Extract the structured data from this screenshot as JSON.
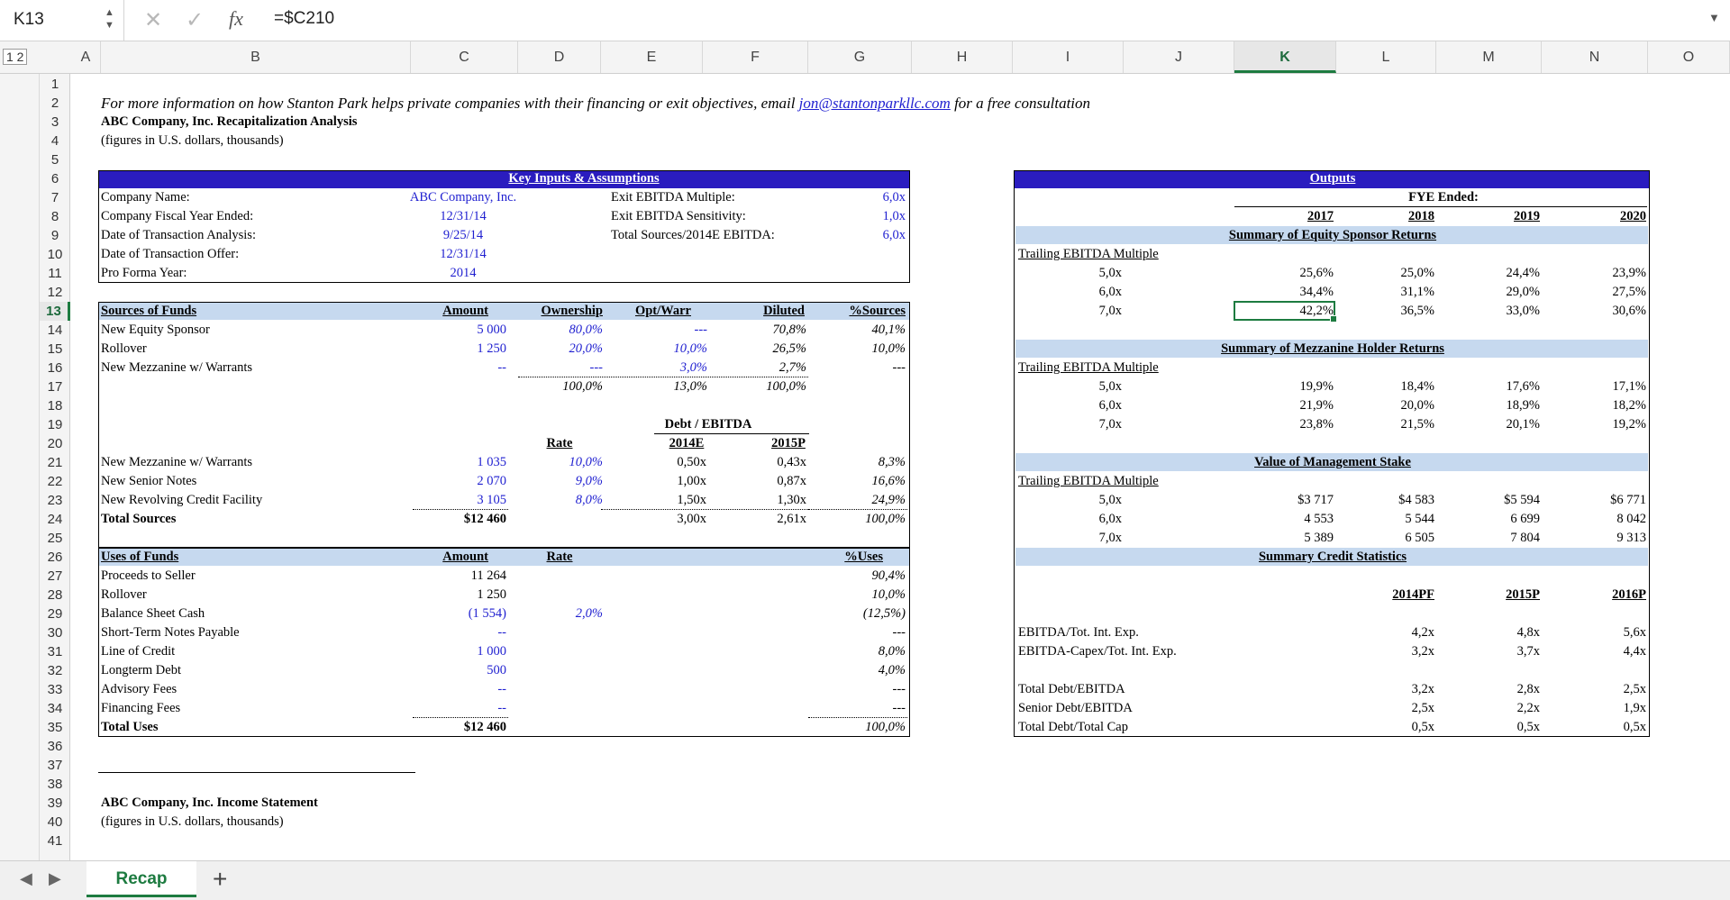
{
  "formula_bar": {
    "name_box": "K13",
    "fx": "fx",
    "formula": "=$C210"
  },
  "columns": [
    "A",
    "B",
    "C",
    "D",
    "E",
    "F",
    "G",
    "H",
    "I",
    "J",
    "K",
    "L",
    "M",
    "N",
    "O"
  ],
  "outline_levels": "1 2",
  "rows": [
    "1",
    "2",
    "3",
    "4",
    "5",
    "6",
    "7",
    "8",
    "9",
    "10",
    "11",
    "12",
    "13",
    "14",
    "15",
    "16",
    "17",
    "18",
    "19",
    "20",
    "21",
    "22",
    "23",
    "24",
    "25",
    "26",
    "27",
    "28",
    "29",
    "30",
    "31",
    "32",
    "33",
    "34",
    "35",
    "36",
    "37",
    "38",
    "39",
    "40",
    "41"
  ],
  "header": {
    "info_pre": "For more information on how Stanton Park helps private companies with their financing or exit objectives, email ",
    "info_email": "jon@stantonparkllc.com",
    "info_post": " for a free consultation",
    "title": "ABC Company, Inc. Recapitalization Analysis",
    "subtitle": "(figures in U.S. dollars, thousands)"
  },
  "key_inputs": {
    "title": "Key Inputs & Assumptions",
    "labels": [
      "Company Name:",
      "Company Fiscal Year Ended:",
      "Date of Transaction Analysis:",
      "Date of Transaction Offer:",
      "Pro Forma Year:"
    ],
    "values": [
      "ABC Company, Inc.",
      "12/31/14",
      "9/25/14",
      "12/31/14",
      "2014"
    ],
    "right_labels": [
      "Exit EBITDA Multiple:",
      "Exit EBITDA Sensitivity:",
      "Total Sources/2014E EBITDA:"
    ],
    "right_values": [
      "6,0x",
      "1,0x",
      "6,0x"
    ]
  },
  "sources": {
    "headers": [
      "Sources of Funds",
      "Amount",
      "Ownership",
      "Opt/Warr",
      "Diluted",
      "%Sources"
    ],
    "rows": [
      {
        "label": "New Equity Sponsor",
        "amount": "5 000",
        "own": "80,0%",
        "opt": "---",
        "dil": "70,8%",
        "pct": "40,1%"
      },
      {
        "label": "Rollover",
        "amount": "1 250",
        "own": "20,0%",
        "opt": "10,0%",
        "dil": "26,5%",
        "pct": "10,0%"
      },
      {
        "label": "New Mezzanine w/ Warrants",
        "amount": "--",
        "own": "---",
        "opt": "3,0%",
        "dil": "2,7%",
        "pct": "---"
      }
    ],
    "totals": {
      "own": "100,0%",
      "opt": "13,0%",
      "dil": "100,0%"
    },
    "debt_ebitda_title": "Debt / EBITDA",
    "rate_header": "Rate",
    "year_headers": [
      "2014E",
      "2015P"
    ],
    "debt_rows": [
      {
        "label": "New Mezzanine w/ Warrants",
        "amount": "1 035",
        "rate": "10,0%",
        "y1": "0,50x",
        "y2": "0,43x",
        "pct": "8,3%"
      },
      {
        "label": "New Senior Notes",
        "amount": "2 070",
        "rate": "9,0%",
        "y1": "1,00x",
        "y2": "0,87x",
        "pct": "16,6%"
      },
      {
        "label": "New Revolving Credit Facility",
        "amount": "3 105",
        "rate": "8,0%",
        "y1": "1,50x",
        "y2": "1,30x",
        "pct": "24,9%"
      }
    ],
    "total_label": "Total Sources",
    "total": {
      "amount": "$12 460",
      "y1": "3,00x",
      "y2": "2,61x",
      "pct": "100,0%"
    }
  },
  "uses": {
    "headers": [
      "Uses of Funds",
      "Amount",
      "Rate",
      "%Uses"
    ],
    "rows": [
      {
        "label": "Proceeds to Seller",
        "amount": "11 264",
        "rate": "",
        "pct": "90,4%"
      },
      {
        "label": "Rollover",
        "amount": "1 250",
        "rate": "",
        "pct": "10,0%"
      },
      {
        "label": "Balance Sheet Cash",
        "amount": "(1 554)",
        "rate": "2,0%",
        "pct": "(12,5%)"
      },
      {
        "label": "Short-Term Notes Payable",
        "amount": "--",
        "rate": "",
        "pct": "---"
      },
      {
        "label": "Line of Credit",
        "amount": "1 000",
        "rate": "",
        "pct": "8,0%"
      },
      {
        "label": "Longterm Debt",
        "amount": "500",
        "rate": "",
        "pct": "4,0%"
      },
      {
        "label": "Advisory Fees",
        "amount": "--",
        "rate": "",
        "pct": "---"
      },
      {
        "label": "Financing Fees",
        "amount": "--",
        "rate": "",
        "pct": "---"
      }
    ],
    "total_label": "Total Uses",
    "total": {
      "amount": "$12 460",
      "pct": "100,0%"
    }
  },
  "outputs": {
    "title": "Outputs",
    "fye": "FYE Ended:",
    "years": [
      "2017",
      "2018",
      "2019",
      "2020"
    ],
    "equity_title": "Summary of Equity Sponsor Returns",
    "multiple_label": "Trailing EBITDA Multiple",
    "multiples": [
      "5,0x",
      "6,0x",
      "7,0x"
    ],
    "equity": [
      [
        "25,6%",
        "25,0%",
        "24,4%",
        "23,9%"
      ],
      [
        "34,4%",
        "31,1%",
        "29,0%",
        "27,5%"
      ],
      [
        "42,2%",
        "36,5%",
        "33,0%",
        "30,6%"
      ]
    ],
    "mezz_title": "Summary of Mezzanine Holder Returns",
    "mezz": [
      [
        "19,9%",
        "18,4%",
        "17,6%",
        "17,1%"
      ],
      [
        "21,9%",
        "20,0%",
        "18,9%",
        "18,2%"
      ],
      [
        "23,8%",
        "21,5%",
        "20,1%",
        "19,2%"
      ]
    ],
    "mgmt_title": "Value of Management Stake",
    "mgmt": [
      [
        "$3 717",
        "$4 583",
        "$5 594",
        "$6 771"
      ],
      [
        "4 553",
        "5 544",
        "6 699",
        "8 042"
      ],
      [
        "5 389",
        "6 505",
        "7 804",
        "9 313"
      ]
    ],
    "credit_title": "Summary Credit Statistics",
    "credit_years": [
      "2014PF",
      "2015P",
      "2016P"
    ],
    "credit": [
      {
        "label": "EBITDA/Tot. Int. Exp.",
        "v": [
          "4,2x",
          "4,8x",
          "5,6x"
        ]
      },
      {
        "label": "EBITDA-Capex/Tot. Int. Exp.",
        "v": [
          "3,2x",
          "3,7x",
          "4,4x"
        ]
      },
      {
        "label": "Total Debt/EBITDA",
        "v": [
          "3,2x",
          "2,8x",
          "2,5x"
        ]
      },
      {
        "label": "Senior Debt/EBITDA",
        "v": [
          "2,5x",
          "2,2x",
          "1,9x"
        ]
      },
      {
        "label": "Total Debt/Total Cap",
        "v": [
          "0,5x",
          "0,5x",
          "0,5x"
        ]
      }
    ]
  },
  "income": {
    "title": "ABC Company, Inc. Income Statement",
    "subtitle": "(figures in U.S. dollars, thousands)"
  },
  "tabs": {
    "sheet": "Recap",
    "add": "+"
  },
  "colors": {
    "accent": "#1d7b40",
    "band": "#c6d9ef",
    "header_band": "#2a1cbf",
    "input_blue": "#1f1fd0"
  }
}
